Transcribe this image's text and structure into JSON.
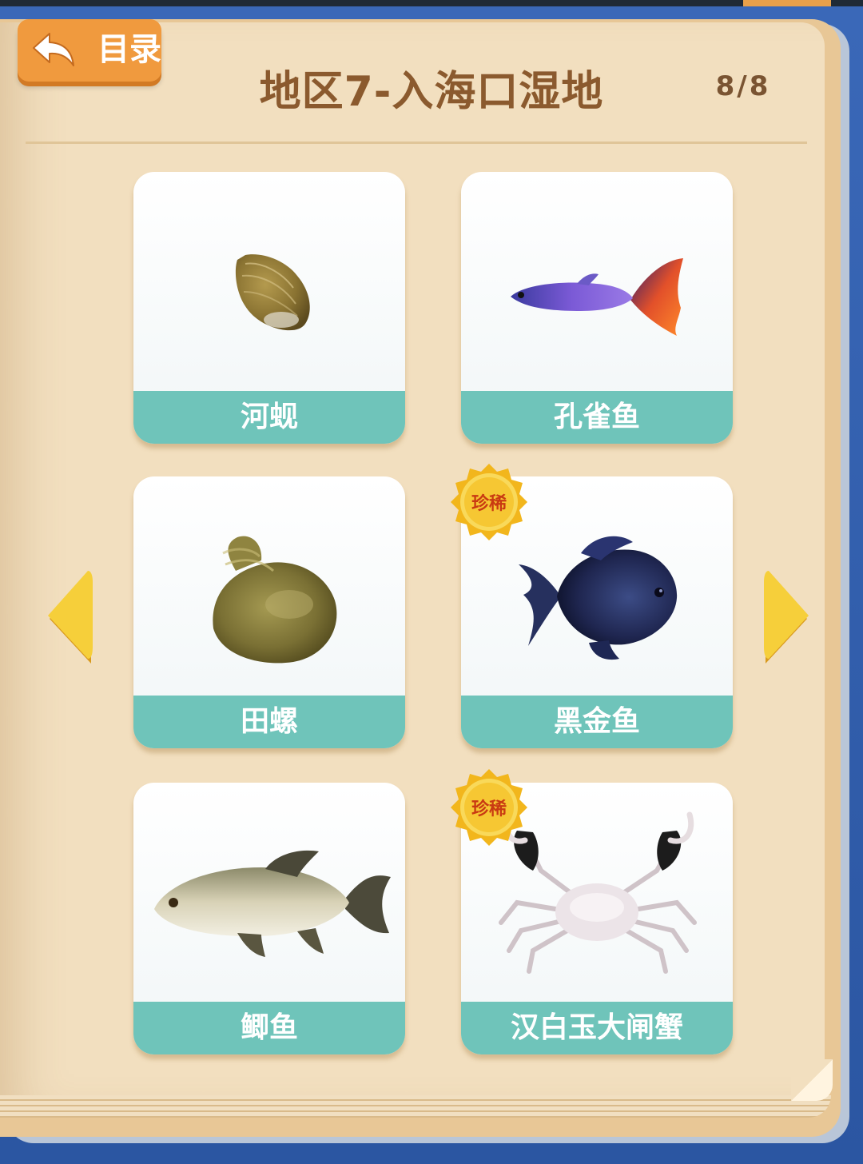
{
  "header": {
    "back_label": "目录",
    "title": "地区7-入海口湿地",
    "page_counter": "8/8"
  },
  "rare_label": "珍稀",
  "species": [
    {
      "name": "河蚬",
      "rare": false,
      "icon": "clam-icon"
    },
    {
      "name": "孔雀鱼",
      "rare": false,
      "icon": "guppy-icon"
    },
    {
      "name": "田螺",
      "rare": false,
      "icon": "snail-icon"
    },
    {
      "name": "黑金鱼",
      "rare": true,
      "icon": "black-goldfish-icon"
    },
    {
      "name": "鲫鱼",
      "rare": false,
      "icon": "crucian-carp-icon"
    },
    {
      "name": "汉白玉大闸蟹",
      "rare": true,
      "icon": "crab-icon"
    }
  ],
  "colors": {
    "name_bar": "#6fc4ba",
    "back_button": "#f09a3e",
    "title": "#8b5a2e",
    "arrow": "#f6cf3a"
  }
}
